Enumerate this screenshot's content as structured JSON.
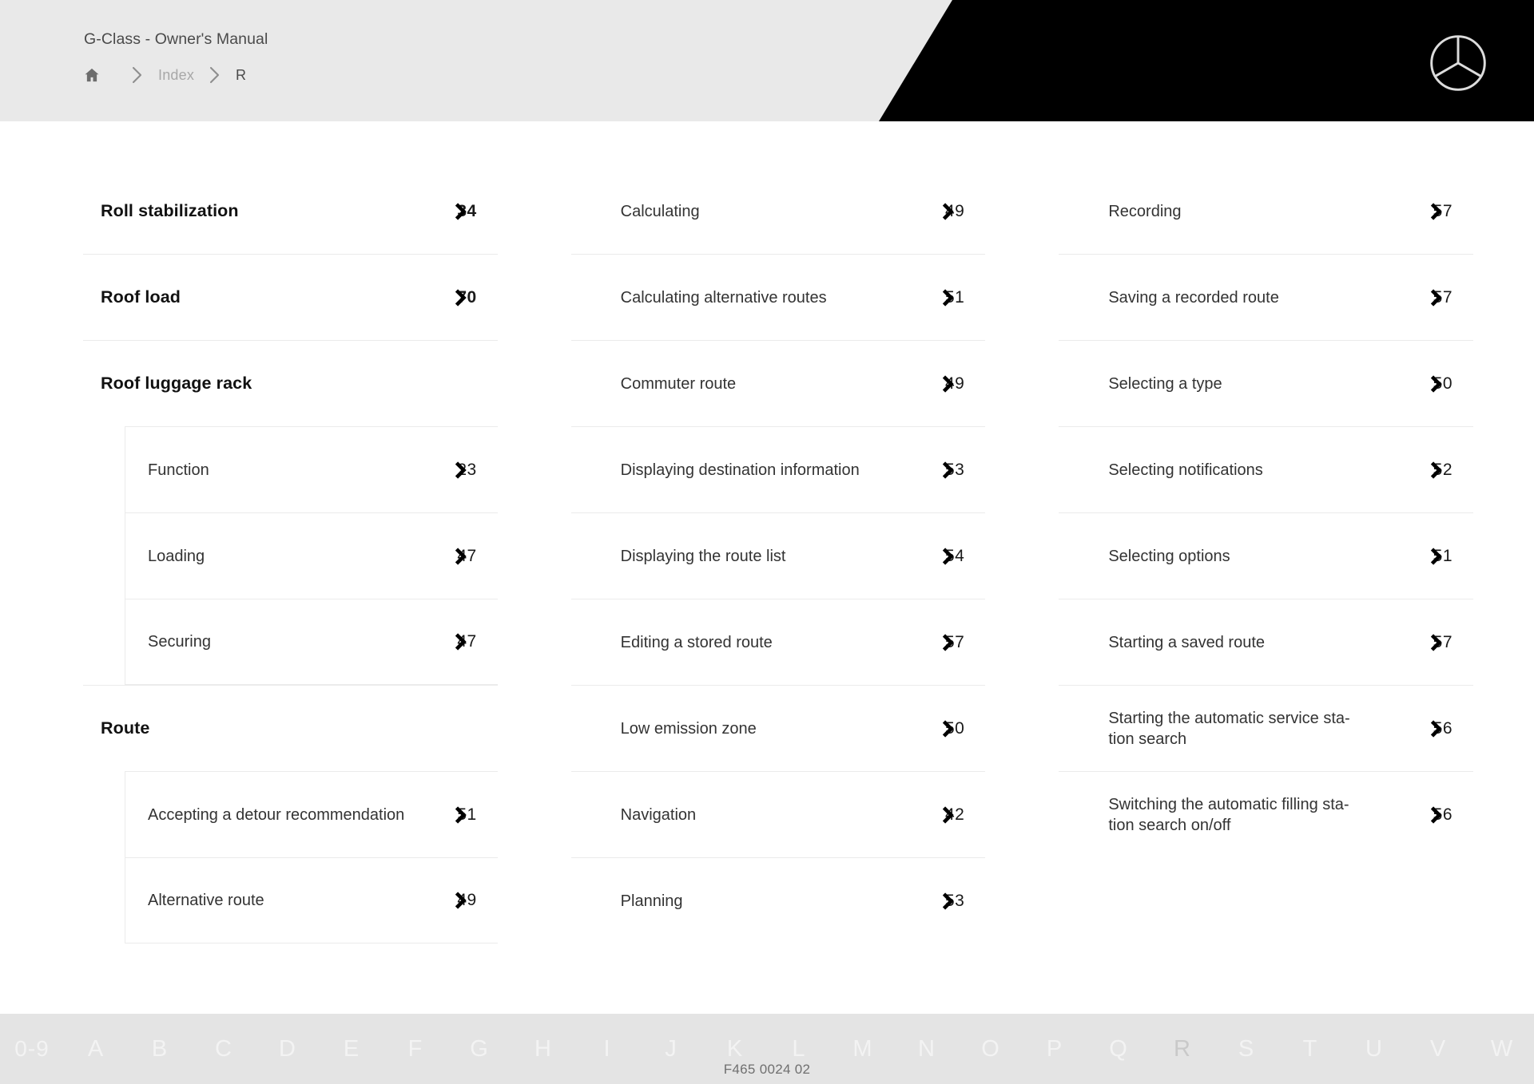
{
  "header": {
    "title": "G-Class - Owner's Manual",
    "breadcrumb": {
      "home_icon": "home-icon",
      "separator_icon": "chevron-right-icon",
      "items": [
        {
          "label": "Index",
          "current": false
        },
        {
          "label": "R",
          "current": true
        }
      ]
    },
    "logo": "mercedes-benz-star-logo"
  },
  "index": {
    "link_icon": "chevron-right-icon",
    "columns": [
      {
        "entries": [
          {
            "label": "Roll stabilization",
            "page": "34",
            "level": "head",
            "link": true
          },
          {
            "label": "Roof load",
            "page": "70",
            "level": "head",
            "link": true
          },
          {
            "label": "Roof luggage rack",
            "page": "",
            "level": "head",
            "link": false
          },
          {
            "label": "Function",
            "page": "23",
            "level": "sub",
            "link": true,
            "group": "start"
          },
          {
            "label": "Loading",
            "page": "47",
            "level": "sub",
            "link": true,
            "group": "mid"
          },
          {
            "label": "Securing",
            "page": "47",
            "level": "sub",
            "link": true,
            "group": "end"
          },
          {
            "label": "Route",
            "page": "",
            "level": "head",
            "link": false
          },
          {
            "label": "Accepting a detour recommendation",
            "page": "51",
            "level": "sub",
            "link": true,
            "group": "start"
          },
          {
            "label": "Alternative route",
            "page": "49",
            "level": "sub",
            "link": true,
            "group": "end"
          }
        ]
      },
      {
        "entries": [
          {
            "label": "Calculating",
            "page": "49",
            "level": "sub",
            "link": true
          },
          {
            "label": "Calculating alternative routes",
            "page": "51",
            "level": "sub",
            "link": true
          },
          {
            "label": "Commuter route",
            "page": "49",
            "level": "sub",
            "link": true
          },
          {
            "label": "Displaying destination information",
            "page": "53",
            "level": "sub",
            "link": true
          },
          {
            "label": "Displaying the route list",
            "page": "54",
            "level": "sub",
            "link": true
          },
          {
            "label": "Editing a stored route",
            "page": "57",
            "level": "sub",
            "link": true
          },
          {
            "label": "Low emission zone",
            "page": "50",
            "level": "sub",
            "link": true
          },
          {
            "label": "Navigation",
            "page": "42",
            "level": "sub",
            "link": true
          },
          {
            "label": "Planning",
            "page": "53",
            "level": "sub",
            "link": true
          }
        ]
      },
      {
        "entries": [
          {
            "label": "Recording",
            "page": "57",
            "level": "sub",
            "link": true
          },
          {
            "label": "Saving a recorded route",
            "page": "57",
            "level": "sub",
            "link": true
          },
          {
            "label": "Selecting a type",
            "page": "50",
            "level": "sub",
            "link": true
          },
          {
            "label": "Selecting notifications",
            "page": "52",
            "level": "sub",
            "link": true
          },
          {
            "label": "Selecting options",
            "page": "51",
            "level": "sub",
            "link": true
          },
          {
            "label": "Starting a saved route",
            "page": "57",
            "level": "sub",
            "link": true
          },
          {
            "label": "Starting the automatic service sta-\ntion search",
            "page": "56",
            "level": "sub",
            "link": true
          },
          {
            "label": "Switching the automatic filling sta-\ntion search on/off",
            "page": "56",
            "level": "sub",
            "link": true
          }
        ]
      }
    ]
  },
  "footer": {
    "letters": [
      "0-9",
      "A",
      "B",
      "C",
      "D",
      "E",
      "F",
      "G",
      "H",
      "I",
      "J",
      "K",
      "L",
      "M",
      "N",
      "O",
      "P",
      "Q",
      "R",
      "S",
      "T",
      "U",
      "V",
      "W"
    ],
    "active_letter": "R",
    "code": "F465 0024 02"
  },
  "colors": {
    "header_bg": "#e9e9e9",
    "header_black": "#000000",
    "footer_bg": "#e4e4e4",
    "page_bg": "#ffffff",
    "rule": "#ebebeb",
    "text_primary": "#111111",
    "text_secondary": "#4a4a4a",
    "text_muted": "#a8a8a8",
    "alpha_letter": "#f3f3f3",
    "alpha_letter_active": "#c9c9c9"
  }
}
